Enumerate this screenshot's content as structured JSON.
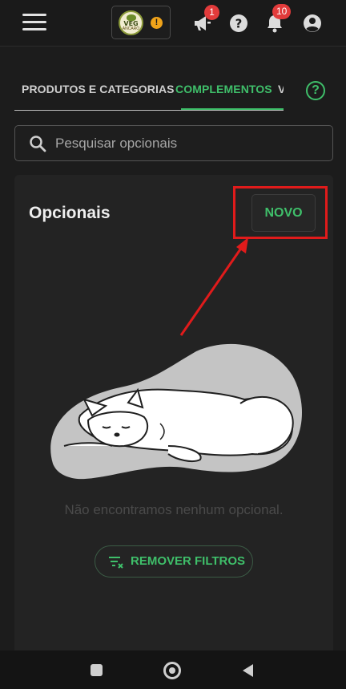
{
  "header": {
    "menu_icon": "hamburger-icon",
    "store_logo": {
      "text": "VEG",
      "subtext": "ANCARO",
      "warning": "!"
    },
    "announcements_badge": "1",
    "notifications_badge": "10"
  },
  "tabs": [
    {
      "label": "PRODUTOS E CATEGORIAS",
      "active": false
    },
    {
      "label": "COMPLEMENTOS",
      "active": true
    },
    {
      "label": "V",
      "active": false
    }
  ],
  "help_label": "?",
  "search": {
    "placeholder": "Pesquisar opcionais",
    "value": ""
  },
  "panel": {
    "title": "Opcionais",
    "new_button": "NOVO",
    "empty_message": "Não encontramos nenhum opcional.",
    "remove_filters_button": "REMOVER FILTROS"
  },
  "colors": {
    "accent": "#3fbf6a",
    "badge": "#e23b3b",
    "annotation": "#e01b1b",
    "background": "#1c1c1c",
    "panel": "#232323"
  }
}
